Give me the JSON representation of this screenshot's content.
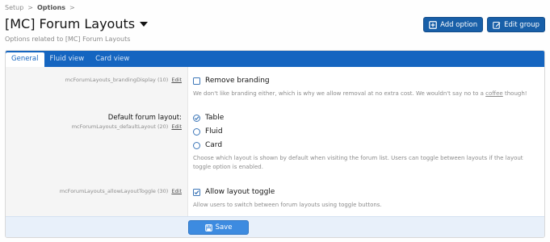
{
  "breadcrumb": {
    "items": [
      "Setup",
      "Options"
    ],
    "separator": ">"
  },
  "header": {
    "title": "[MC] Forum Layouts",
    "description": "Options related to [MC] Forum Layouts",
    "add_option_label": "Add option",
    "edit_group_label": "Edit group"
  },
  "tabs": [
    {
      "label": "General",
      "active": true
    },
    {
      "label": "Fluid view",
      "active": false
    },
    {
      "label": "Card view",
      "active": false
    }
  ],
  "options": {
    "branding": {
      "id_label": "mcForumLayouts_brandingDisplay (10)",
      "edit_label": "Edit",
      "checkbox_label": "Remove branding",
      "checked": false,
      "hint_text": "We don't like branding either, which is why we allow removal at no extra cost. We wouldn't say no to a",
      "hint_link": "coffee",
      "hint_suffix": "though!"
    },
    "default_layout": {
      "title": "Default forum layout:",
      "id_label": "mcForumLayouts_defaultLayout (20)",
      "edit_label": "Edit",
      "choices": [
        {
          "label": "Table",
          "selected": true
        },
        {
          "label": "Fluid",
          "selected": false
        },
        {
          "label": "Card",
          "selected": false
        }
      ],
      "hint": "Choose which layout is shown by default when visiting the forum list. Users can toggle between layouts if the layout toggle option is enabled."
    },
    "layout_toggle": {
      "id_label": "mcForumLayouts_allowLayoutToggle (30)",
      "edit_label": "Edit",
      "checkbox_label": "Allow layout toggle",
      "checked": true,
      "hint": "Allow users to switch between forum layouts using toggle buttons."
    }
  },
  "footer": {
    "save_label": "Save"
  },
  "colors": {
    "accent": "#1565c0",
    "button": "#185fa8",
    "save": "#3d8be0",
    "footer_bg": "#e8f0fa"
  }
}
